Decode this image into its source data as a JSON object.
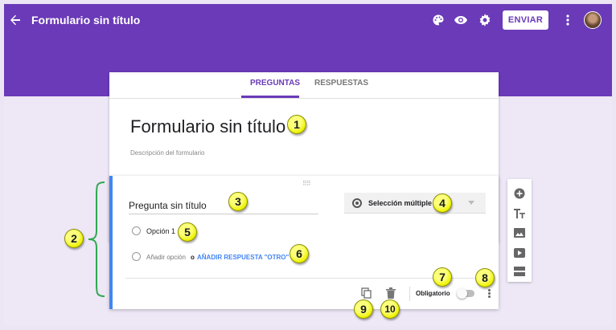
{
  "header": {
    "title": "Formulario sin título",
    "send_label": "ENVIAR",
    "color": "#6a3ab8"
  },
  "tabs": [
    {
      "label": "PREGUNTAS",
      "active": true
    },
    {
      "label": "RESPUESTAS",
      "active": false
    }
  ],
  "form": {
    "title": "Formulario sin título",
    "description_placeholder": "Descripción del formulario"
  },
  "question": {
    "title": "Pregunta sin título",
    "type_label": "Selección múltiple",
    "option1": "Opción 1",
    "add_option": "Añadir opción",
    "or_text": "o",
    "add_other": "AÑADIR RESPUESTA \"OTRO\"",
    "required_label": "Obligatorio",
    "required": false,
    "accent": "#4285f4"
  },
  "icons": {
    "header": [
      "back-arrow-icon",
      "palette-icon",
      "eye-icon",
      "gear-icon",
      "more-vert-icon",
      "avatar"
    ],
    "side_toolbar": [
      "add-circle-icon",
      "title-text-icon",
      "image-icon",
      "video-icon",
      "section-icon"
    ],
    "footer": [
      "duplicate-icon",
      "trash-icon",
      "more-vert-icon"
    ]
  },
  "callouts": [
    "1",
    "2",
    "3",
    "4",
    "5",
    "6",
    "7",
    "8",
    "9",
    "10"
  ]
}
